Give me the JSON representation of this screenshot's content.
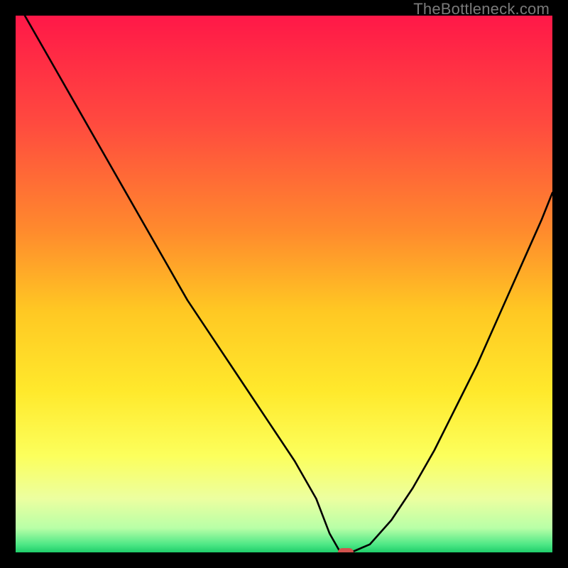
{
  "watermark": {
    "text": "TheBottleneck.com"
  },
  "colors": {
    "background": "#000000",
    "marker": "#d2534e",
    "curve": "#000000",
    "gradient_stops": [
      {
        "offset": 0.0,
        "color": "#ff1848"
      },
      {
        "offset": 0.2,
        "color": "#ff4a3f"
      },
      {
        "offset": 0.4,
        "color": "#ff8a2d"
      },
      {
        "offset": 0.55,
        "color": "#ffc823"
      },
      {
        "offset": 0.7,
        "color": "#ffe92c"
      },
      {
        "offset": 0.82,
        "color": "#fcff5c"
      },
      {
        "offset": 0.9,
        "color": "#ecffa0"
      },
      {
        "offset": 0.955,
        "color": "#b8ffa7"
      },
      {
        "offset": 0.985,
        "color": "#4fe886"
      },
      {
        "offset": 1.0,
        "color": "#1fce6a"
      }
    ]
  },
  "chart_data": {
    "type": "line",
    "title": "",
    "xlabel": "",
    "ylabel": "",
    "xlim": [
      0,
      100
    ],
    "ylim": [
      0,
      100
    ],
    "grid": false,
    "legend": false,
    "x": [
      0,
      4,
      8,
      12,
      16,
      20,
      24,
      28,
      32,
      36,
      40,
      44,
      48,
      52,
      56,
      58.5,
      60.5,
      62.5,
      66,
      70,
      74,
      78,
      82,
      86,
      90,
      94,
      98,
      100
    ],
    "values": [
      103,
      96,
      89,
      82,
      75,
      68,
      61,
      54,
      47,
      41,
      35,
      29,
      23,
      17,
      10,
      3.5,
      0,
      0,
      1.5,
      6,
      12,
      19,
      27,
      35,
      44,
      53,
      62,
      67
    ],
    "marker": {
      "x": 61.5,
      "y": 0
    }
  }
}
